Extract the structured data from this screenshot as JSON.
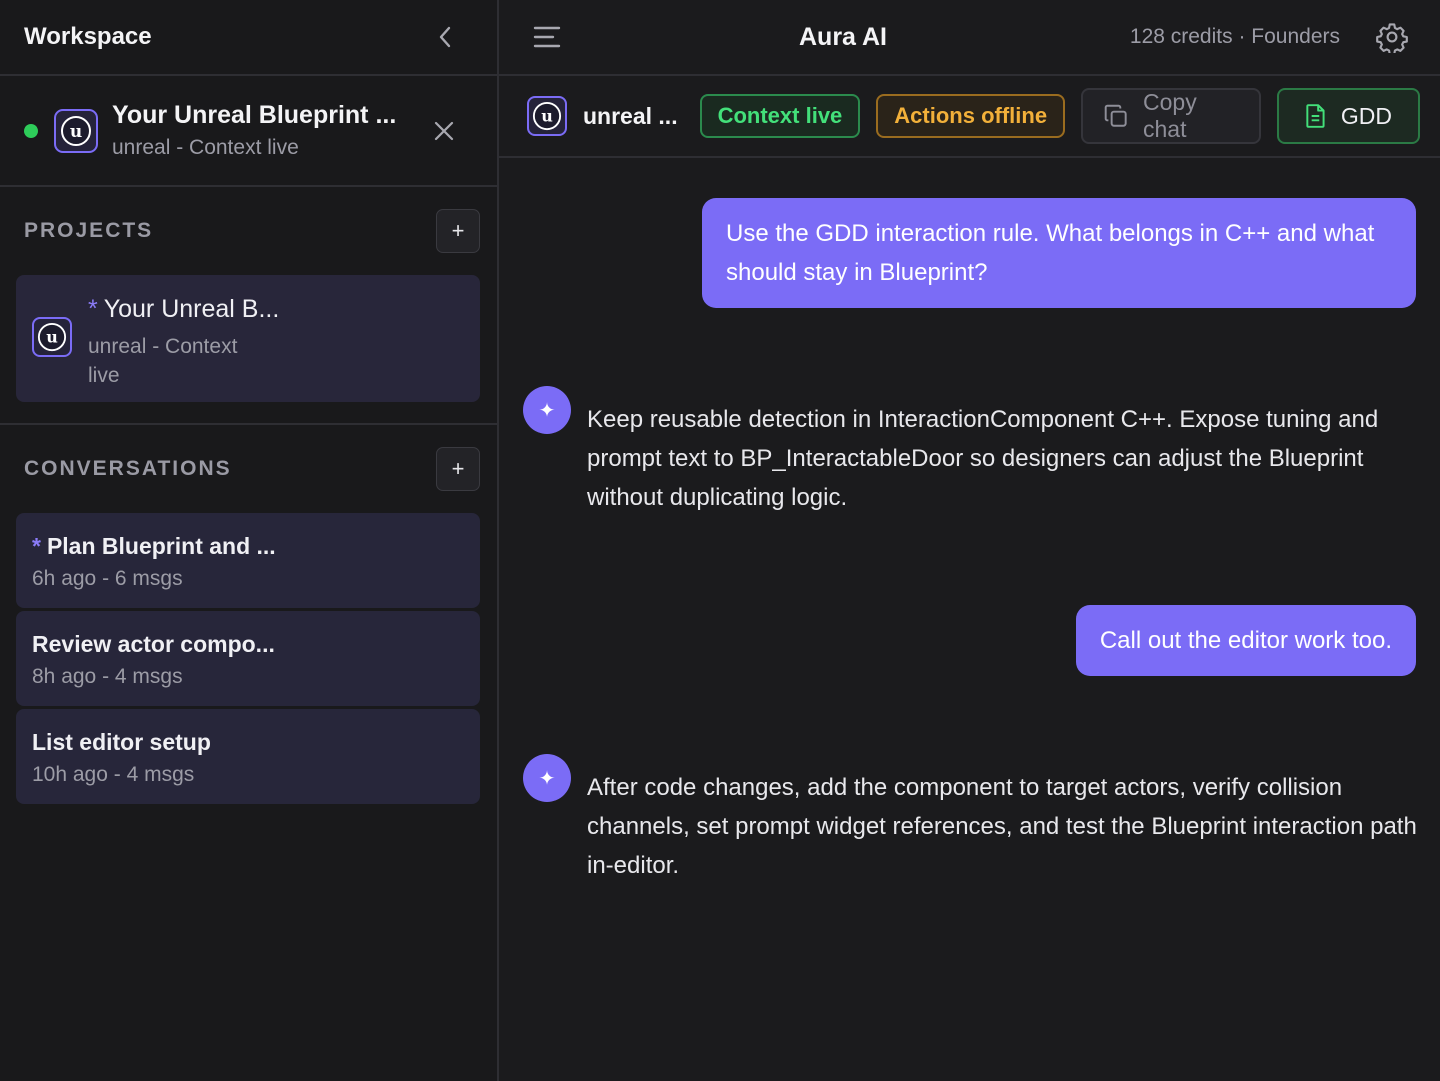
{
  "sidebar": {
    "title": "Workspace",
    "active_project": {
      "name": "Your Unreal Blueprint ...",
      "subtitle": "unreal - Context live",
      "status_color": "#2ecc5a"
    },
    "projects_label": "PROJECTS",
    "projects": [
      {
        "star": "*",
        "name": "Your Unreal B...",
        "subtitle": "unreal - Context live"
      }
    ],
    "conversations_label": "CONVERSATIONS",
    "conversations": [
      {
        "star": "*",
        "title": "Plan Blueprint and ...",
        "meta": "6h ago - 6 msgs"
      },
      {
        "star": "",
        "title": "Review actor compo...",
        "meta": "8h ago - 4 msgs"
      },
      {
        "star": "",
        "title": "List editor setup",
        "meta": "10h ago - 4 msgs"
      }
    ],
    "add_symbol": "+"
  },
  "header": {
    "title": "Aura AI",
    "credits": "128 credits · Founders"
  },
  "context_bar": {
    "project_name": "unreal ...",
    "context_status": "Context live",
    "actions_status": "Actions offline",
    "copy_label": "Copy chat",
    "gdd_label": "GDD"
  },
  "messages": [
    {
      "role": "user",
      "text": "Use the GDD interaction rule. What belongs in C++ and what should stay in Blueprint?"
    },
    {
      "role": "assistant",
      "text": "Keep reusable detection in InteractionComponent C++. Expose tuning and prompt text to BP_InteractableDoor so designers can adjust the Blueprint without duplicating logic."
    },
    {
      "role": "user",
      "text": "Call out the editor work too."
    },
    {
      "role": "assistant",
      "text": "After code changes, add the component to target actors, verify collision channels, set prompt widget references, and test the Blueprint interaction path in-editor."
    }
  ],
  "colors": {
    "accent": "#7b6cf6",
    "live": "#43e07a",
    "offline": "#f2b03a"
  },
  "icons": {
    "collapse": "chevron-left-icon",
    "close": "close-icon",
    "menu": "menu-icon",
    "settings": "gear-icon",
    "copy": "copy-icon",
    "document": "document-icon",
    "assistant": "sparkle-icon",
    "logo": "unreal-logo-icon"
  }
}
